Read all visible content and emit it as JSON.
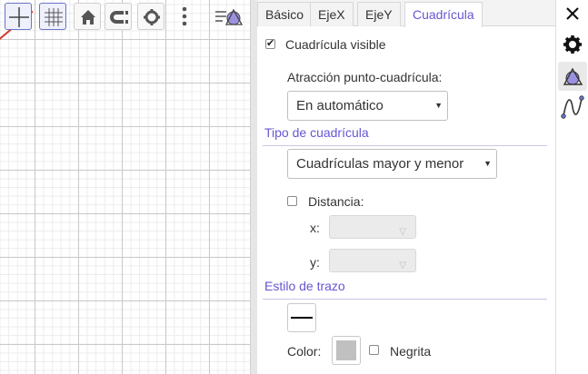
{
  "graphics_view": {
    "toolbar": [
      {
        "name": "axes-toggle-icon"
      },
      {
        "name": "grid-toggle-icon"
      },
      {
        "name": "home-icon"
      },
      {
        "name": "point-capture-icon"
      },
      {
        "name": "gear-icon"
      },
      {
        "name": "more-vertical-icon"
      },
      {
        "name": "style-bar-icon"
      }
    ],
    "accent_color": "#6557d2",
    "function_color": "#d23a32"
  },
  "tabs": [
    {
      "label": "Básico"
    },
    {
      "label": "EjeX"
    },
    {
      "label": "EjeY"
    },
    {
      "label": "Cuadrícula",
      "active": true
    }
  ],
  "grid": {
    "visible_label": "Cuadrícula visible",
    "visible_checked": true,
    "snap_label": "Atracción punto-cuadrícula:",
    "snap_value": "En automático",
    "type_section": "Tipo de cuadrícula",
    "type_value": "Cuadrículas mayor y menor",
    "distance_label": "Distancia:",
    "distance_checked": false,
    "x_label": "x:",
    "y_label": "y:",
    "x_value": "",
    "y_value": ""
  },
  "line_style": {
    "section": "Estilo de trazo",
    "color_label": "Color:",
    "color_value": "#c0c0c0",
    "bold_label": "Negrita",
    "bold_checked": false
  },
  "side_strip": [
    {
      "name": "close-icon"
    },
    {
      "name": "gear-icon"
    },
    {
      "name": "graphics-view-icon",
      "active": true
    },
    {
      "name": "algebra-curve-icon"
    }
  ]
}
